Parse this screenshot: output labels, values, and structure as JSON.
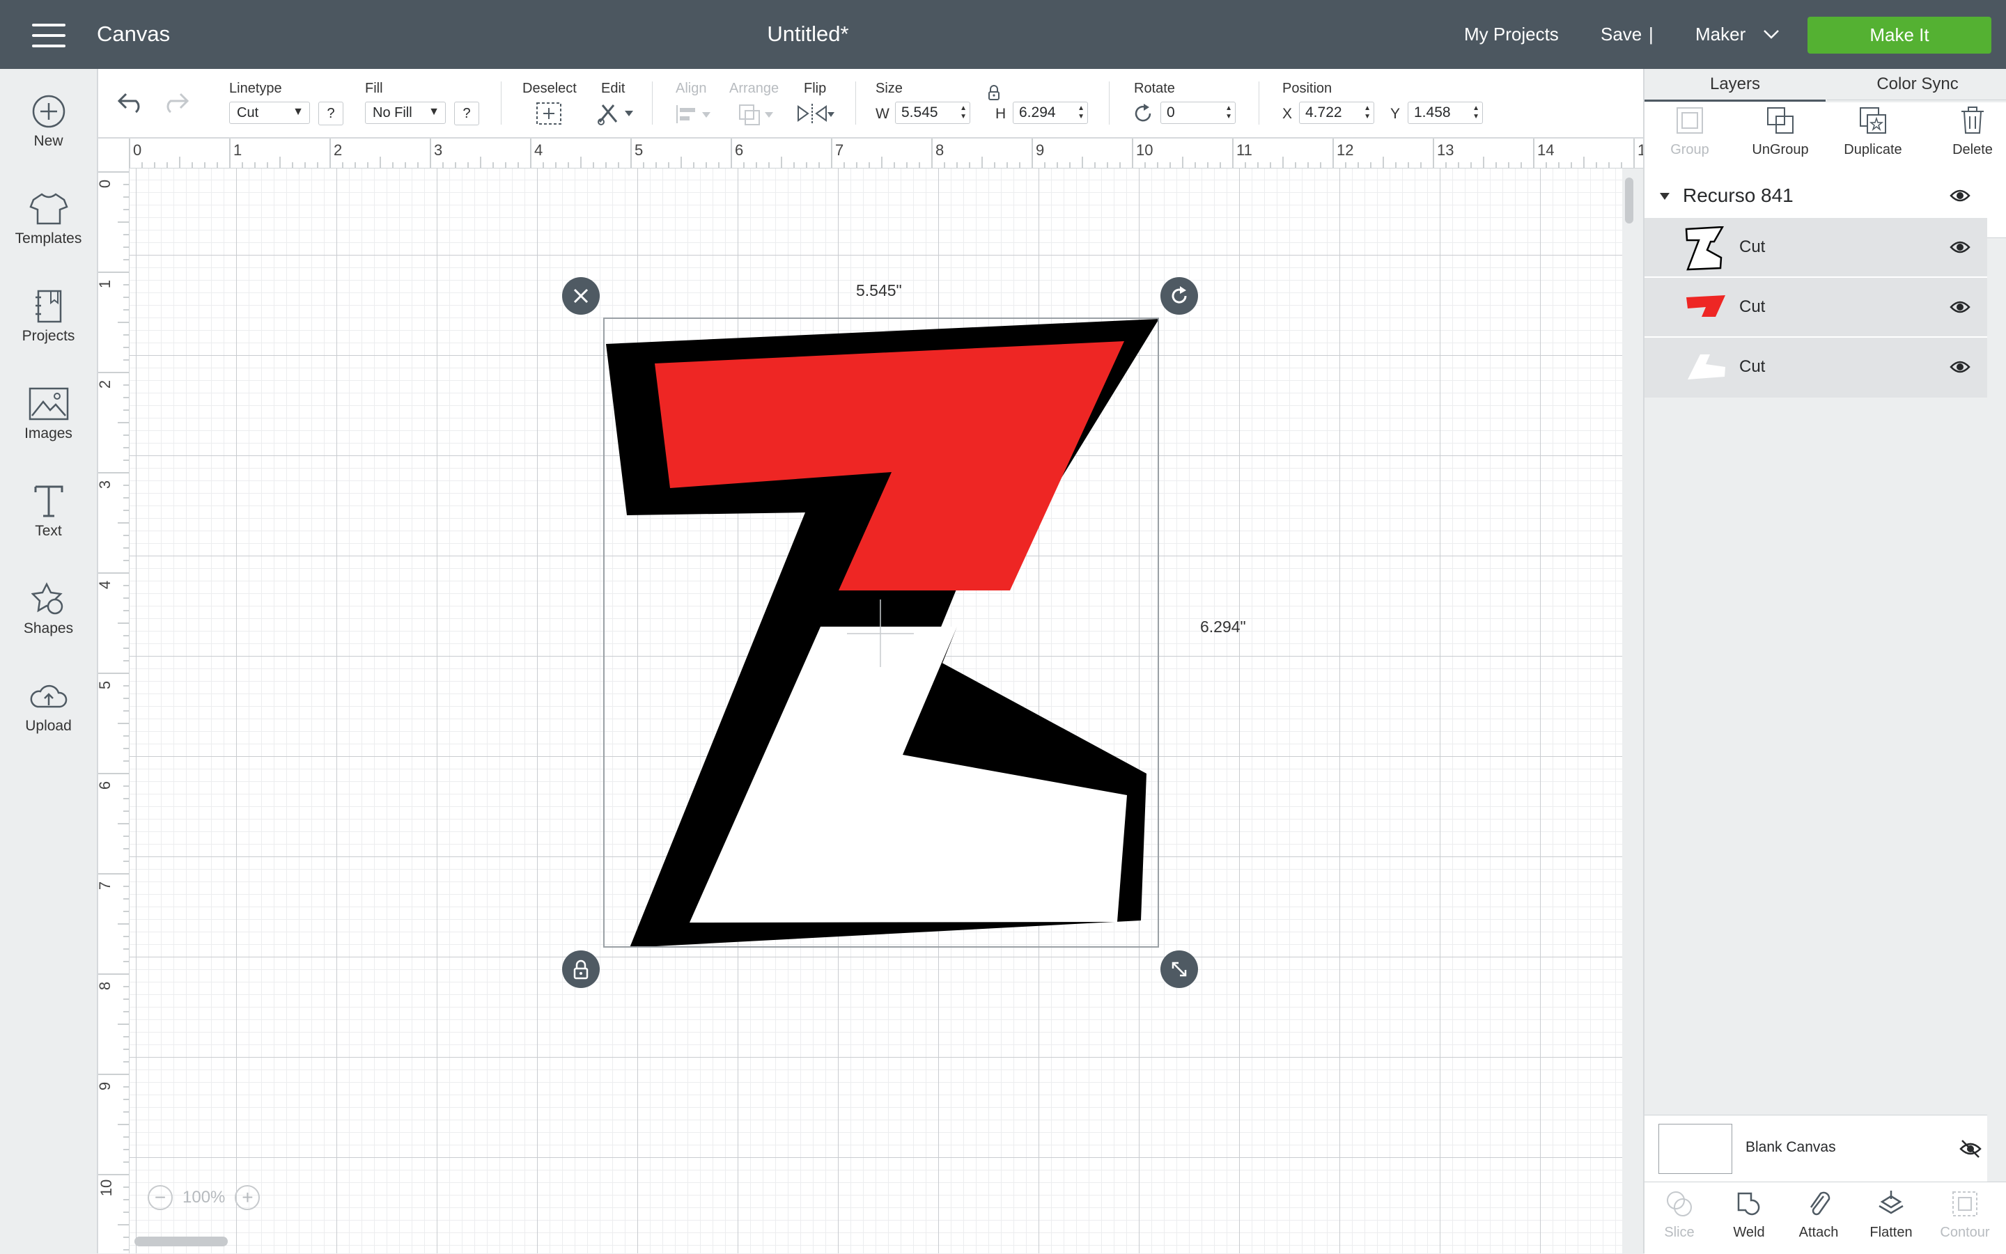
{
  "topbar": {
    "app_title": "Canvas",
    "doc_title": "Untitled*",
    "my_projects": "My Projects",
    "save": "Save",
    "separator": "|",
    "machine": "Maker",
    "make_it": "Make It",
    "make_it_color": "#54b132",
    "bar_color": "#4c5760"
  },
  "sidebar": {
    "items": [
      {
        "label": "New",
        "icon": "plus-circle-icon"
      },
      {
        "label": "Templates",
        "icon": "tshirt-icon"
      },
      {
        "label": "Projects",
        "icon": "notebook-icon"
      },
      {
        "label": "Images",
        "icon": "image-icon"
      },
      {
        "label": "Text",
        "icon": "text-t-icon"
      },
      {
        "label": "Shapes",
        "icon": "shapes-icon"
      },
      {
        "label": "Upload",
        "icon": "cloud-upload-icon"
      }
    ]
  },
  "toolbar": {
    "linetype_label": "Linetype",
    "linetype_value": "Cut",
    "fill_label": "Fill",
    "fill_value": "No Fill",
    "help": "?",
    "deselect_label": "Deselect",
    "edit_label": "Edit",
    "align_label": "Align",
    "arrange_label": "Arrange",
    "flip_label": "Flip",
    "size_label": "Size",
    "w_label": "W",
    "w_value": "5.545",
    "h_label": "H",
    "h_value": "6.294",
    "rotate_label": "Rotate",
    "rotate_value": "0",
    "position_label": "Position",
    "x_label": "X",
    "x_value": "4.722",
    "y_label": "Y",
    "y_value": "1.458"
  },
  "rulers": {
    "top": [
      "0",
      "1",
      "2",
      "3",
      "4",
      "5",
      "6",
      "7",
      "8",
      "9",
      "10",
      "11",
      "12",
      "13",
      "14",
      "1"
    ],
    "left": [
      "0",
      "1",
      "2",
      "3",
      "4",
      "5",
      "6",
      "7",
      "8",
      "9",
      "10"
    ]
  },
  "canvas": {
    "width_label": "5.545\"",
    "height_label": "6.294\"",
    "zoom": "100%",
    "colors": {
      "outline": "#000000",
      "top": "#ee2624",
      "bottom": "#ffffff"
    }
  },
  "layers_panel": {
    "tab_layers": "Layers",
    "tab_color_sync": "Color Sync",
    "actions": {
      "group": "Group",
      "ungroup": "UnGroup",
      "duplicate": "Duplicate",
      "delete": "Delete"
    },
    "group_name": "Recurso 841",
    "layers": [
      {
        "name": "Cut",
        "thumb": "z-outline-thumb"
      },
      {
        "name": "Cut",
        "thumb": "red-shape-thumb"
      },
      {
        "name": "Cut",
        "thumb": "white-shape-thumb"
      }
    ],
    "blank_canvas": "Blank Canvas",
    "bottom_actions": {
      "slice": "Slice",
      "weld": "Weld",
      "attach": "Attach",
      "flatten": "Flatten",
      "contour": "Contour"
    }
  }
}
